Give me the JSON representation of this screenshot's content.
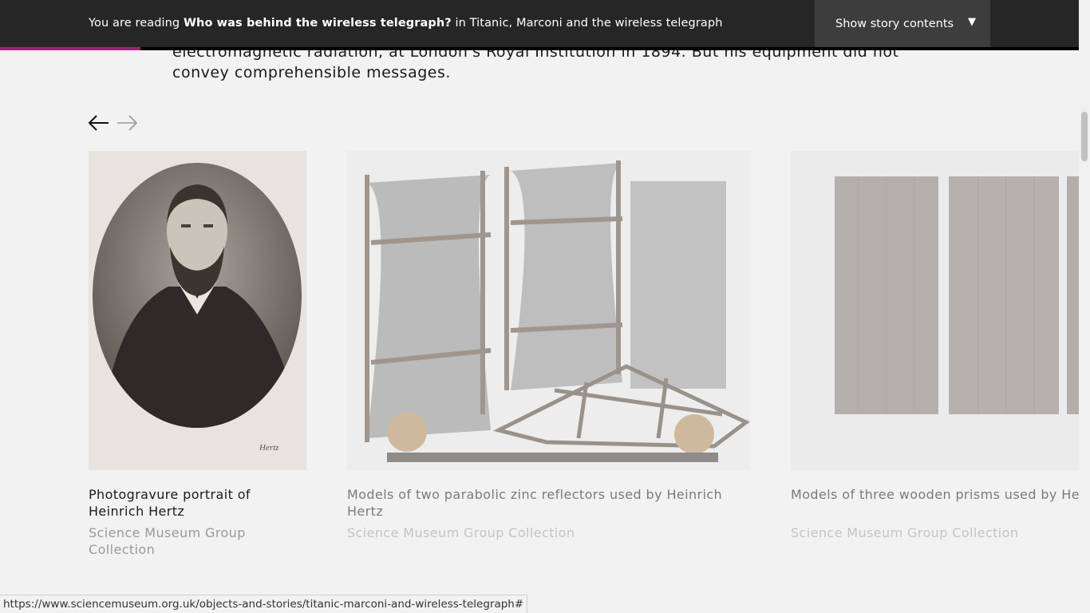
{
  "topbar": {
    "prefix": "You are reading ",
    "story_title": "Who was behind the wireless telegraph?",
    "middle": " in ",
    "collection": "Titanic, Marconi and the wireless telegraph",
    "contents_label": "Show story contents",
    "caret": "▼",
    "progress_percent": 13
  },
  "article": {
    "cut_line": "electromagnetic radiation, at London's Royal Institution in 1894. But his equipment did not",
    "line2": "convey comprehensible messages."
  },
  "carousel": {
    "prev_icon": "arrow-left-icon",
    "next_icon": "arrow-right-icon",
    "cards": [
      {
        "title": "Photogravure portrait of Heinrich Hertz",
        "source": "Science Museum Group Collection",
        "signature": "Hertz"
      },
      {
        "title": "Models of two parabolic zinc reflectors used by Heinrich Hertz",
        "source": "Science Museum Group Collection"
      },
      {
        "title": "Models of three wooden prisms used by Heinrich Hertz",
        "source": "Science Museum Group Collection"
      }
    ]
  },
  "status_url": "https://www.sciencemuseum.org.uk/objects-and-stories/titanic-marconi-and-wireless-telegraph#"
}
